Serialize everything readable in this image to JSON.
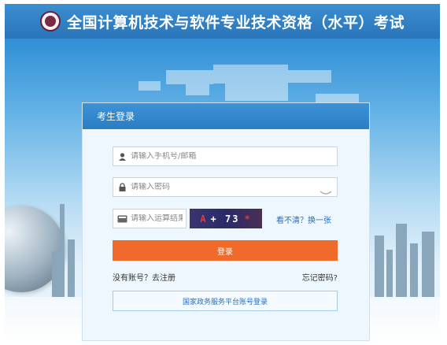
{
  "header": {
    "title": "全国计算机技术与软件专业技术资格（水平）考试"
  },
  "login": {
    "panel_title": "考生登录",
    "username": {
      "placeholder": "请输入手机号/邮箱",
      "value": ""
    },
    "password": {
      "placeholder": "请输入密码",
      "value": ""
    },
    "captcha": {
      "placeholder": "请输入运算结果",
      "value": "",
      "image_text": "+ 73",
      "refresh_label": "看不清？换一张"
    },
    "submit_label": "登录",
    "register_label": "没有账号？去注册",
    "forgot_label": "忘记密码?",
    "gov_login_label": "国家政务服务平台账号登录"
  },
  "colors": {
    "header": "#2a74b9",
    "submit": "#f06a2c",
    "link": "#2a6fb8"
  }
}
